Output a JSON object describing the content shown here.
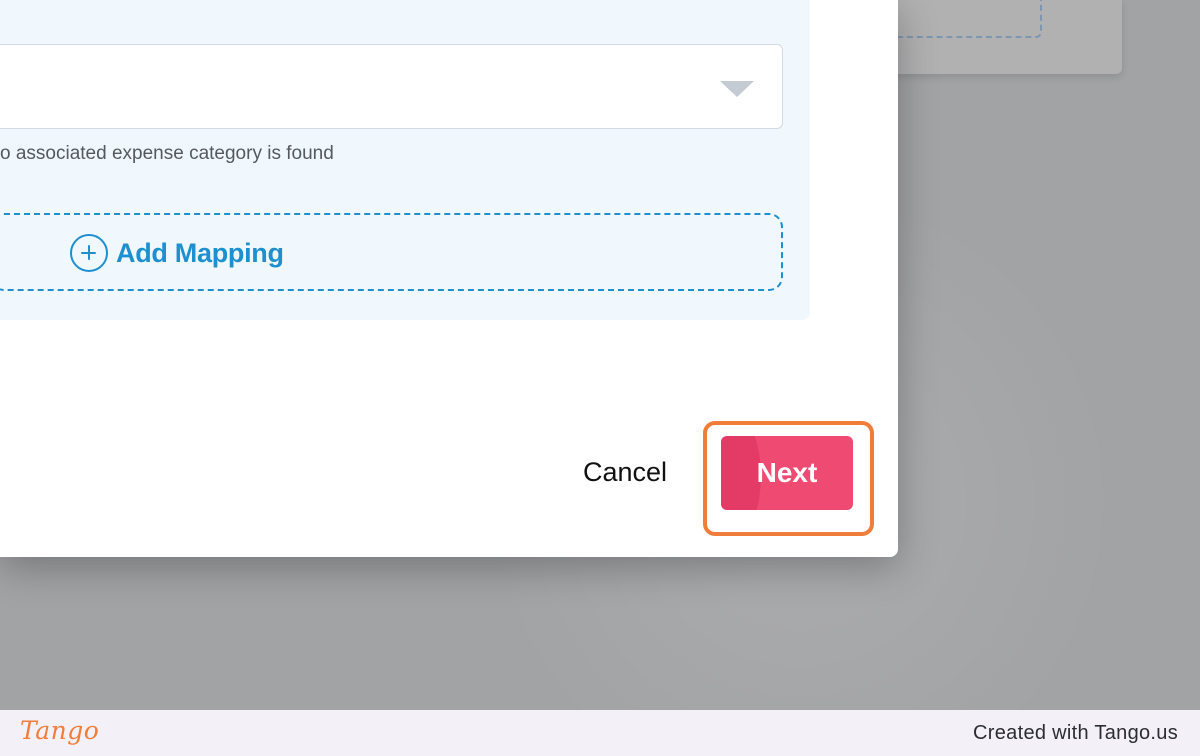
{
  "mapping_panel": {
    "helper_text": "o associated expense category is found",
    "add_mapping_label": "Add Mapping"
  },
  "actions": {
    "cancel_label": "Cancel",
    "next_label": "Next"
  },
  "footer": {
    "logo_text": "Tango",
    "created_with": "Created with Tango.us"
  },
  "colors": {
    "accent_blue": "#1e8fcf",
    "next_button": "#ef4a72",
    "highlight_outline": "#f17d3b",
    "panel_background": "#f1f8fd"
  },
  "icons": {
    "select_arrow": "chevron-down-icon",
    "add_mapping": "plus-circle-icon"
  }
}
